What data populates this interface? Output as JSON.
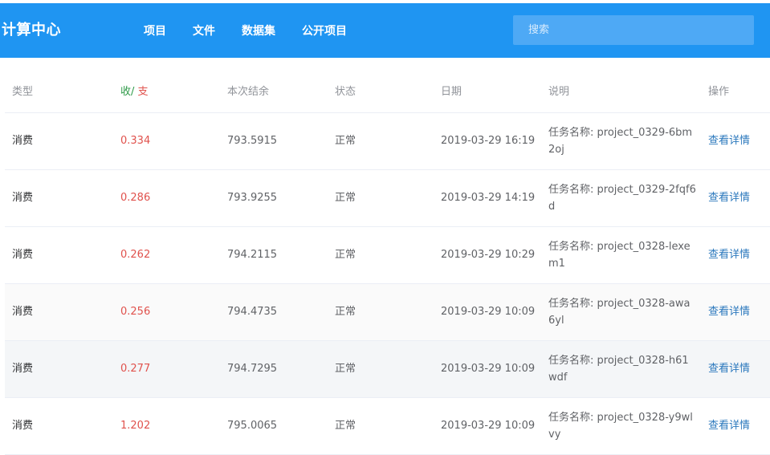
{
  "app": {
    "brand": "计算中心",
    "nav": [
      "项目",
      "文件",
      "数据集",
      "公开项目"
    ],
    "search_placeholder": "搜索"
  },
  "table": {
    "headers": {
      "type": "类型",
      "amount_in": "收",
      "amount_sep": "/ ",
      "amount_out": "支",
      "balance": "本次结余",
      "status": "状态",
      "date": "日期",
      "desc": "说明",
      "action": "操作"
    },
    "rows": [
      {
        "type": "消费",
        "amount": "0.334",
        "balance": "793.5915",
        "status": "正常",
        "date": "2019-03-29 16:19",
        "desc": "任务名称: project_0329-6bm2oj",
        "action": "查看详情"
      },
      {
        "type": "消费",
        "amount": "0.286",
        "balance": "793.9255",
        "status": "正常",
        "date": "2019-03-29 14:19",
        "desc": "任务名称: project_0329-2fqf6d",
        "action": "查看详情"
      },
      {
        "type": "消费",
        "amount": "0.262",
        "balance": "794.2115",
        "status": "正常",
        "date": "2019-03-29 10:29",
        "desc": "任务名称: project_0328-lexem1",
        "action": "查看详情"
      },
      {
        "type": "消费",
        "amount": "0.256",
        "balance": "794.4735",
        "status": "正常",
        "date": "2019-03-29 10:09",
        "desc": "任务名称: project_0328-awa6yl",
        "action": "查看详情"
      },
      {
        "type": "消费",
        "amount": "0.277",
        "balance": "794.7295",
        "status": "正常",
        "date": "2019-03-29 10:09",
        "desc": "任务名称: project_0328-h61wdf",
        "action": "查看详情"
      },
      {
        "type": "消费",
        "amount": "1.202",
        "balance": "795.0065",
        "status": "正常",
        "date": "2019-03-29 10:09",
        "desc": "任务名称: project_0328-y9wlvy",
        "action": "查看详情"
      }
    ]
  },
  "colors": {
    "header_bg": "#1f95f2",
    "income": "#2e9a48",
    "expense": "#e0524d",
    "link": "#2b78bd"
  }
}
